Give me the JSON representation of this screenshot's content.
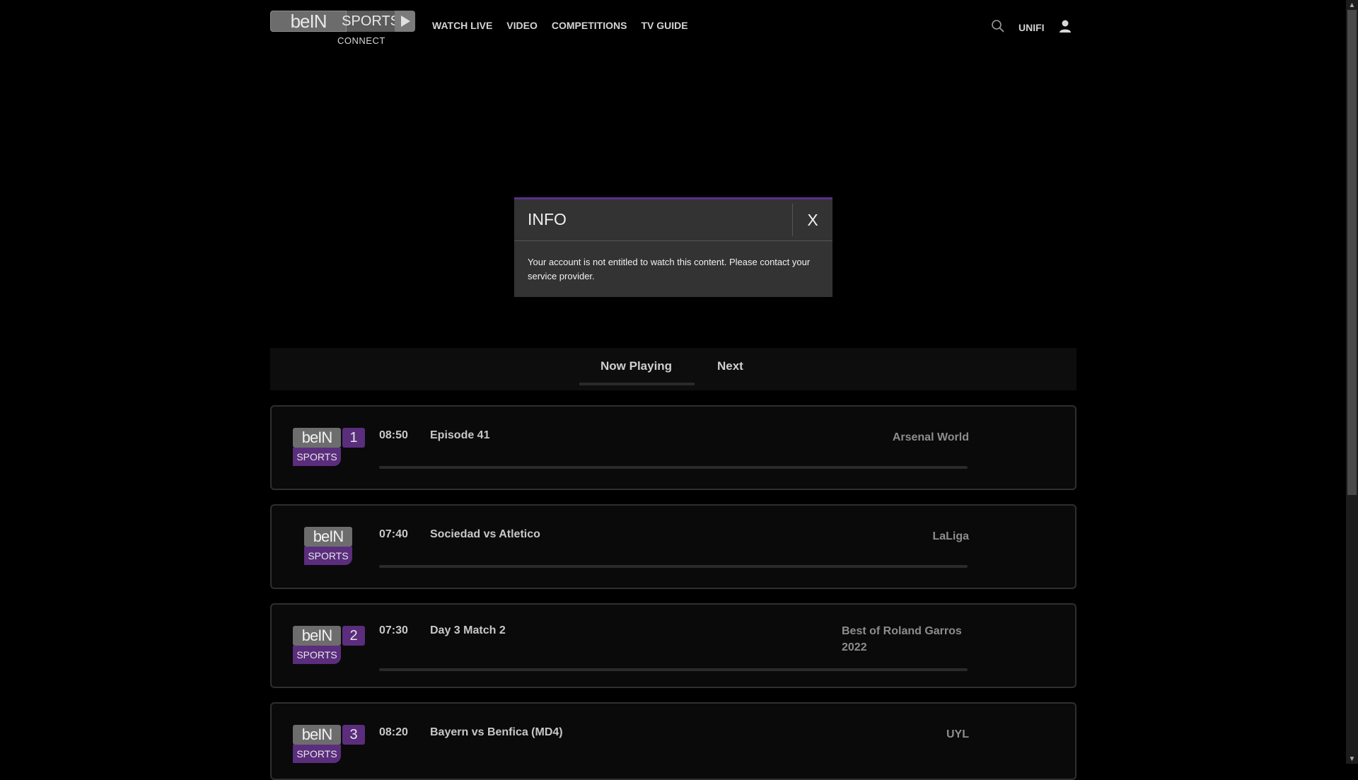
{
  "header": {
    "logo": {
      "bein": "beIN",
      "sports": "SPORTS",
      "connect": "CONNECT"
    },
    "nav": [
      "WATCH LIVE",
      "VIDEO",
      "COMPETITIONS",
      "TV GUIDE"
    ],
    "provider": "UNIFI"
  },
  "modal": {
    "title": "INFO",
    "close_label": "X",
    "message": "Your account is not entitled to watch this content. Please contact your service provider."
  },
  "tabs": {
    "now_playing": "Now Playing",
    "next": "Next"
  },
  "channels": [
    {
      "logo_top": "beIN",
      "logo_bottom": "SPORTS",
      "number": "1",
      "time": "08:50",
      "title": "Episode 41",
      "competition": "Arsenal World",
      "progress": 0
    },
    {
      "logo_top": "beIN",
      "logo_bottom": "SPORTS",
      "number": "",
      "time": "07:40",
      "title": "Sociedad vs Atletico",
      "competition": "LaLiga",
      "progress": 0
    },
    {
      "logo_top": "beIN",
      "logo_bottom": "SPORTS",
      "number": "2",
      "time": "07:30",
      "title": "Day 3 Match 2",
      "competition": "Best of Roland Garros 2022",
      "progress": 0
    },
    {
      "logo_top": "beIN",
      "logo_bottom": "SPORTS",
      "number": "3",
      "time": "08:20",
      "title": "Bayern vs Benfica (MD4)",
      "competition": "UYL",
      "progress": 0
    }
  ],
  "colors": {
    "accent": "#5c2f8f",
    "background": "#000000"
  }
}
